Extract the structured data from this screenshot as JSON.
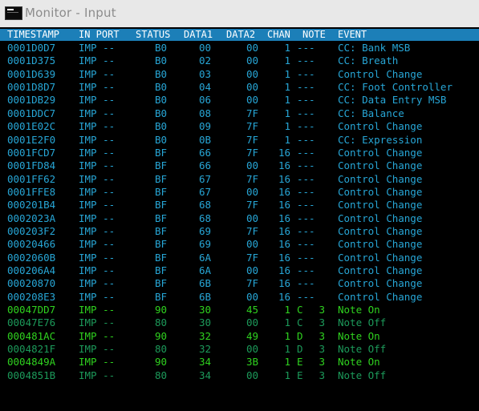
{
  "window": {
    "title": "Monitor - Input"
  },
  "colors": {
    "cyan": "#27a6d6",
    "green_bright": "#2fd21f",
    "green_dim": "#1c9a5a",
    "header_bg": "#1c7fb8"
  },
  "columns": [
    "TIMESTAMP",
    "IN PORT",
    "STATUS",
    "DATA1",
    "DATA2",
    "CHAN",
    "NOTE",
    "EVENT"
  ],
  "rows": [
    {
      "ts": "0001D0D7",
      "port": "IMP --",
      "status": "B0",
      "d1": "00",
      "d2": "00",
      "chan": "1",
      "note": "---",
      "oct": "",
      "event": "CC: Bank MSB",
      "style": "cyan"
    },
    {
      "ts": "0001D375",
      "port": "IMP --",
      "status": "B0",
      "d1": "02",
      "d2": "00",
      "chan": "1",
      "note": "---",
      "oct": "",
      "event": "CC: Breath",
      "style": "cyan"
    },
    {
      "ts": "0001D639",
      "port": "IMP --",
      "status": "B0",
      "d1": "03",
      "d2": "00",
      "chan": "1",
      "note": "---",
      "oct": "",
      "event": "Control Change",
      "style": "cyan"
    },
    {
      "ts": "0001D8D7",
      "port": "IMP --",
      "status": "B0",
      "d1": "04",
      "d2": "00",
      "chan": "1",
      "note": "---",
      "oct": "",
      "event": "CC: Foot Controller",
      "style": "cyan"
    },
    {
      "ts": "0001DB29",
      "port": "IMP --",
      "status": "B0",
      "d1": "06",
      "d2": "00",
      "chan": "1",
      "note": "---",
      "oct": "",
      "event": "CC: Data Entry MSB",
      "style": "cyan"
    },
    {
      "ts": "0001DDC7",
      "port": "IMP --",
      "status": "B0",
      "d1": "08",
      "d2": "7F",
      "chan": "1",
      "note": "---",
      "oct": "",
      "event": "CC: Balance",
      "style": "cyan"
    },
    {
      "ts": "0001E02C",
      "port": "IMP --",
      "status": "B0",
      "d1": "09",
      "d2": "7F",
      "chan": "1",
      "note": "---",
      "oct": "",
      "event": "Control Change",
      "style": "cyan"
    },
    {
      "ts": "0001E2F0",
      "port": "IMP --",
      "status": "B0",
      "d1": "0B",
      "d2": "7F",
      "chan": "1",
      "note": "---",
      "oct": "",
      "event": "CC: Expression",
      "style": "cyan"
    },
    {
      "ts": "0001FCD7",
      "port": "IMP --",
      "status": "BF",
      "d1": "66",
      "d2": "7F",
      "chan": "16",
      "note": "---",
      "oct": "",
      "event": "Control Change",
      "style": "cyan"
    },
    {
      "ts": "0001FD84",
      "port": "IMP --",
      "status": "BF",
      "d1": "66",
      "d2": "00",
      "chan": "16",
      "note": "---",
      "oct": "",
      "event": "Control Change",
      "style": "cyan"
    },
    {
      "ts": "0001FF62",
      "port": "IMP --",
      "status": "BF",
      "d1": "67",
      "d2": "7F",
      "chan": "16",
      "note": "---",
      "oct": "",
      "event": "Control Change",
      "style": "cyan"
    },
    {
      "ts": "0001FFE8",
      "port": "IMP --",
      "status": "BF",
      "d1": "67",
      "d2": "00",
      "chan": "16",
      "note": "---",
      "oct": "",
      "event": "Control Change",
      "style": "cyan"
    },
    {
      "ts": "000201B4",
      "port": "IMP --",
      "status": "BF",
      "d1": "68",
      "d2": "7F",
      "chan": "16",
      "note": "---",
      "oct": "",
      "event": "Control Change",
      "style": "cyan"
    },
    {
      "ts": "0002023A",
      "port": "IMP --",
      "status": "BF",
      "d1": "68",
      "d2": "00",
      "chan": "16",
      "note": "---",
      "oct": "",
      "event": "Control Change",
      "style": "cyan"
    },
    {
      "ts": "000203F2",
      "port": "IMP --",
      "status": "BF",
      "d1": "69",
      "d2": "7F",
      "chan": "16",
      "note": "---",
      "oct": "",
      "event": "Control Change",
      "style": "cyan"
    },
    {
      "ts": "00020466",
      "port": "IMP --",
      "status": "BF",
      "d1": "69",
      "d2": "00",
      "chan": "16",
      "note": "---",
      "oct": "",
      "event": "Control Change",
      "style": "cyan"
    },
    {
      "ts": "0002060B",
      "port": "IMP --",
      "status": "BF",
      "d1": "6A",
      "d2": "7F",
      "chan": "16",
      "note": "---",
      "oct": "",
      "event": "Control Change",
      "style": "cyan"
    },
    {
      "ts": "000206A4",
      "port": "IMP --",
      "status": "BF",
      "d1": "6A",
      "d2": "00",
      "chan": "16",
      "note": "---",
      "oct": "",
      "event": "Control Change",
      "style": "cyan"
    },
    {
      "ts": "00020870",
      "port": "IMP --",
      "status": "BF",
      "d1": "6B",
      "d2": "7F",
      "chan": "16",
      "note": "---",
      "oct": "",
      "event": "Control Change",
      "style": "cyan"
    },
    {
      "ts": "000208E3",
      "port": "IMP --",
      "status": "BF",
      "d1": "6B",
      "d2": "00",
      "chan": "16",
      "note": "---",
      "oct": "",
      "event": "Control Change",
      "style": "cyan"
    },
    {
      "ts": "00047DD7",
      "port": "IMP --",
      "status": "90",
      "d1": "30",
      "d2": "45",
      "chan": "1",
      "note": "C",
      "oct": "3",
      "event": "Note On",
      "style": "green_bright"
    },
    {
      "ts": "00047E76",
      "port": "IMP --",
      "status": "80",
      "d1": "30",
      "d2": "00",
      "chan": "1",
      "note": "C",
      "oct": "3",
      "event": "Note Off",
      "style": "green_dim"
    },
    {
      "ts": "000481AC",
      "port": "IMP --",
      "status": "90",
      "d1": "32",
      "d2": "49",
      "chan": "1",
      "note": "D",
      "oct": "3",
      "event": "Note On",
      "style": "green_bright"
    },
    {
      "ts": "0004821F",
      "port": "IMP --",
      "status": "80",
      "d1": "32",
      "d2": "00",
      "chan": "1",
      "note": "D",
      "oct": "3",
      "event": "Note Off",
      "style": "green_dim"
    },
    {
      "ts": "0004849A",
      "port": "IMP --",
      "status": "90",
      "d1": "34",
      "d2": "3B",
      "chan": "1",
      "note": "E",
      "oct": "3",
      "event": "Note On",
      "style": "green_bright"
    },
    {
      "ts": "0004851B",
      "port": "IMP --",
      "status": "80",
      "d1": "34",
      "d2": "00",
      "chan": "1",
      "note": "E",
      "oct": "3",
      "event": "Note Off",
      "style": "green_dim"
    }
  ]
}
